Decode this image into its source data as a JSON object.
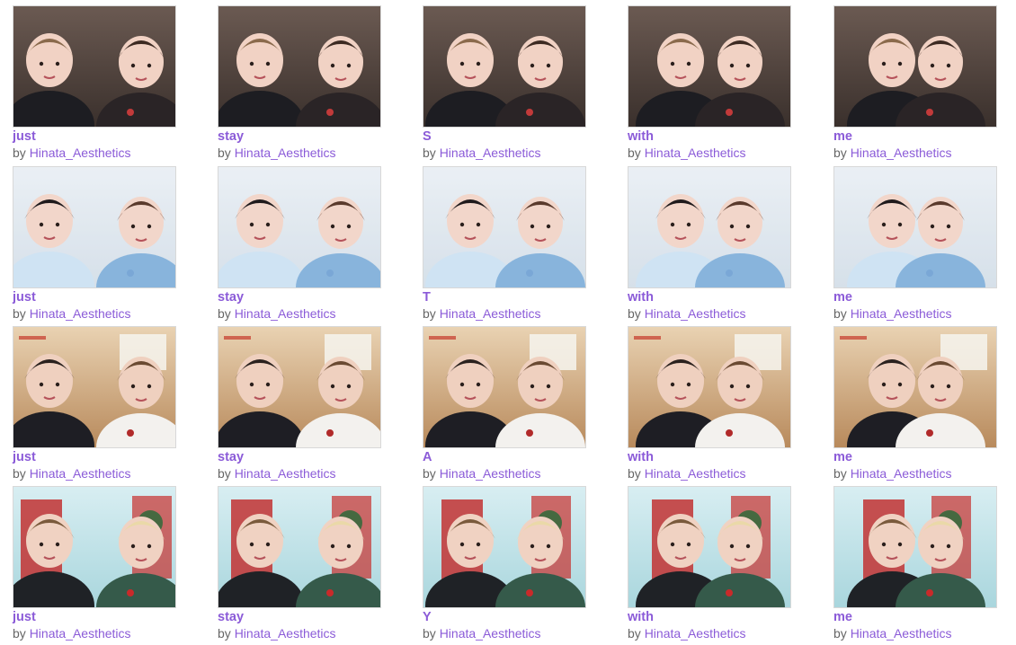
{
  "colors": {
    "link": "#8b5bd8",
    "byline_text": "#666666",
    "thumb_border": "#d8d8d8"
  },
  "byline_prefix": "by",
  "rows": [
    {
      "scene": "dark-close-up",
      "items": [
        {
          "title": "just",
          "author": "Hinata_Aesthetics"
        },
        {
          "title": "stay",
          "author": "Hinata_Aesthetics"
        },
        {
          "title": "S",
          "author": "Hinata_Aesthetics"
        },
        {
          "title": "with",
          "author": "Hinata_Aesthetics"
        },
        {
          "title": "me",
          "author": "Hinata_Aesthetics"
        }
      ]
    },
    {
      "scene": "pale-blue-studio",
      "items": [
        {
          "title": "just",
          "author": "Hinata_Aesthetics"
        },
        {
          "title": "stay",
          "author": "Hinata_Aesthetics"
        },
        {
          "title": "T",
          "author": "Hinata_Aesthetics"
        },
        {
          "title": "with",
          "author": "Hinata_Aesthetics"
        },
        {
          "title": "me",
          "author": "Hinata_Aesthetics"
        }
      ]
    },
    {
      "scene": "warm-classroom",
      "items": [
        {
          "title": "just",
          "author": "Hinata_Aesthetics"
        },
        {
          "title": "stay",
          "author": "Hinata_Aesthetics"
        },
        {
          "title": "A",
          "author": "Hinata_Aesthetics"
        },
        {
          "title": "with",
          "author": "Hinata_Aesthetics"
        },
        {
          "title": "me",
          "author": "Hinata_Aesthetics"
        }
      ]
    },
    {
      "scene": "festive-red-door",
      "items": [
        {
          "title": "just",
          "author": "Hinata_Aesthetics"
        },
        {
          "title": "stay",
          "author": "Hinata_Aesthetics"
        },
        {
          "title": "Y",
          "author": "Hinata_Aesthetics"
        },
        {
          "title": "with",
          "author": "Hinata_Aesthetics"
        },
        {
          "title": "me",
          "author": "Hinata_Aesthetics"
        }
      ]
    }
  ]
}
